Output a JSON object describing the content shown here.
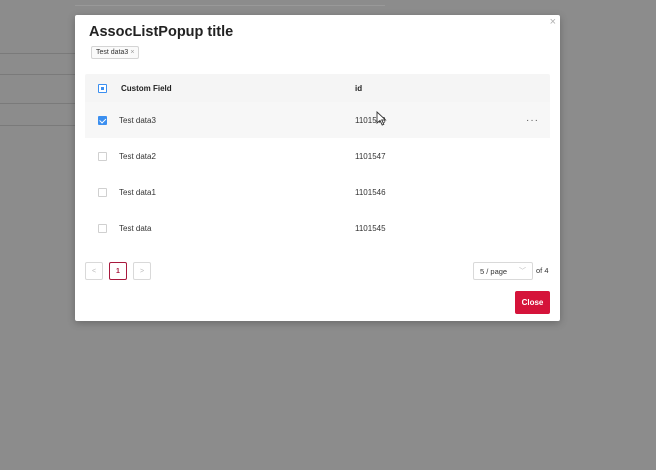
{
  "modal": {
    "title": "AssocListPopup title",
    "close_icon_glyph": "×",
    "selected_tags": [
      {
        "label": "Test data3",
        "remove_glyph": "×"
      }
    ],
    "footer": {
      "close_label": "Close"
    }
  },
  "table": {
    "columns": {
      "field": "Custom Field",
      "id": "id"
    },
    "header_checkbox_state": "indeterminate",
    "rows": [
      {
        "field": "Test data3",
        "id": "1101548",
        "checked": true,
        "more_glyph": "···"
      },
      {
        "field": "Test data2",
        "id": "1101547",
        "checked": false
      },
      {
        "field": "Test data1",
        "id": "1101546",
        "checked": false
      },
      {
        "field": "Test data",
        "id": "1101545",
        "checked": false
      }
    ]
  },
  "pagination": {
    "prev_glyph": "<",
    "current_page": "1",
    "next_glyph": ">",
    "page_size": "5 / page",
    "total_pages_label": "of 4"
  },
  "colors": {
    "primary": "#d5133a",
    "checkbox": "#3b8ff0",
    "overlay": "#8c8c8c"
  }
}
